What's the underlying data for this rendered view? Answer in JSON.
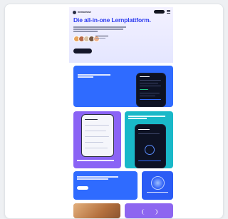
{
  "header": {
    "logo_text": "memorease",
    "menu_icon": "hamburger-icon"
  },
  "hero": {
    "title": "Die all-in-one Lernplattform.",
    "avatar_colors": [
      "#e8a35b",
      "#b86b4b",
      "#d9c1a3",
      "#7a5a44",
      "#f0b18a"
    ]
  },
  "colors": {
    "brand_blue": "#2e3cf0",
    "tile_blue": "#2f6bff",
    "tile_purple": "#8a63f5",
    "tile_teal": "#19b8c8"
  }
}
